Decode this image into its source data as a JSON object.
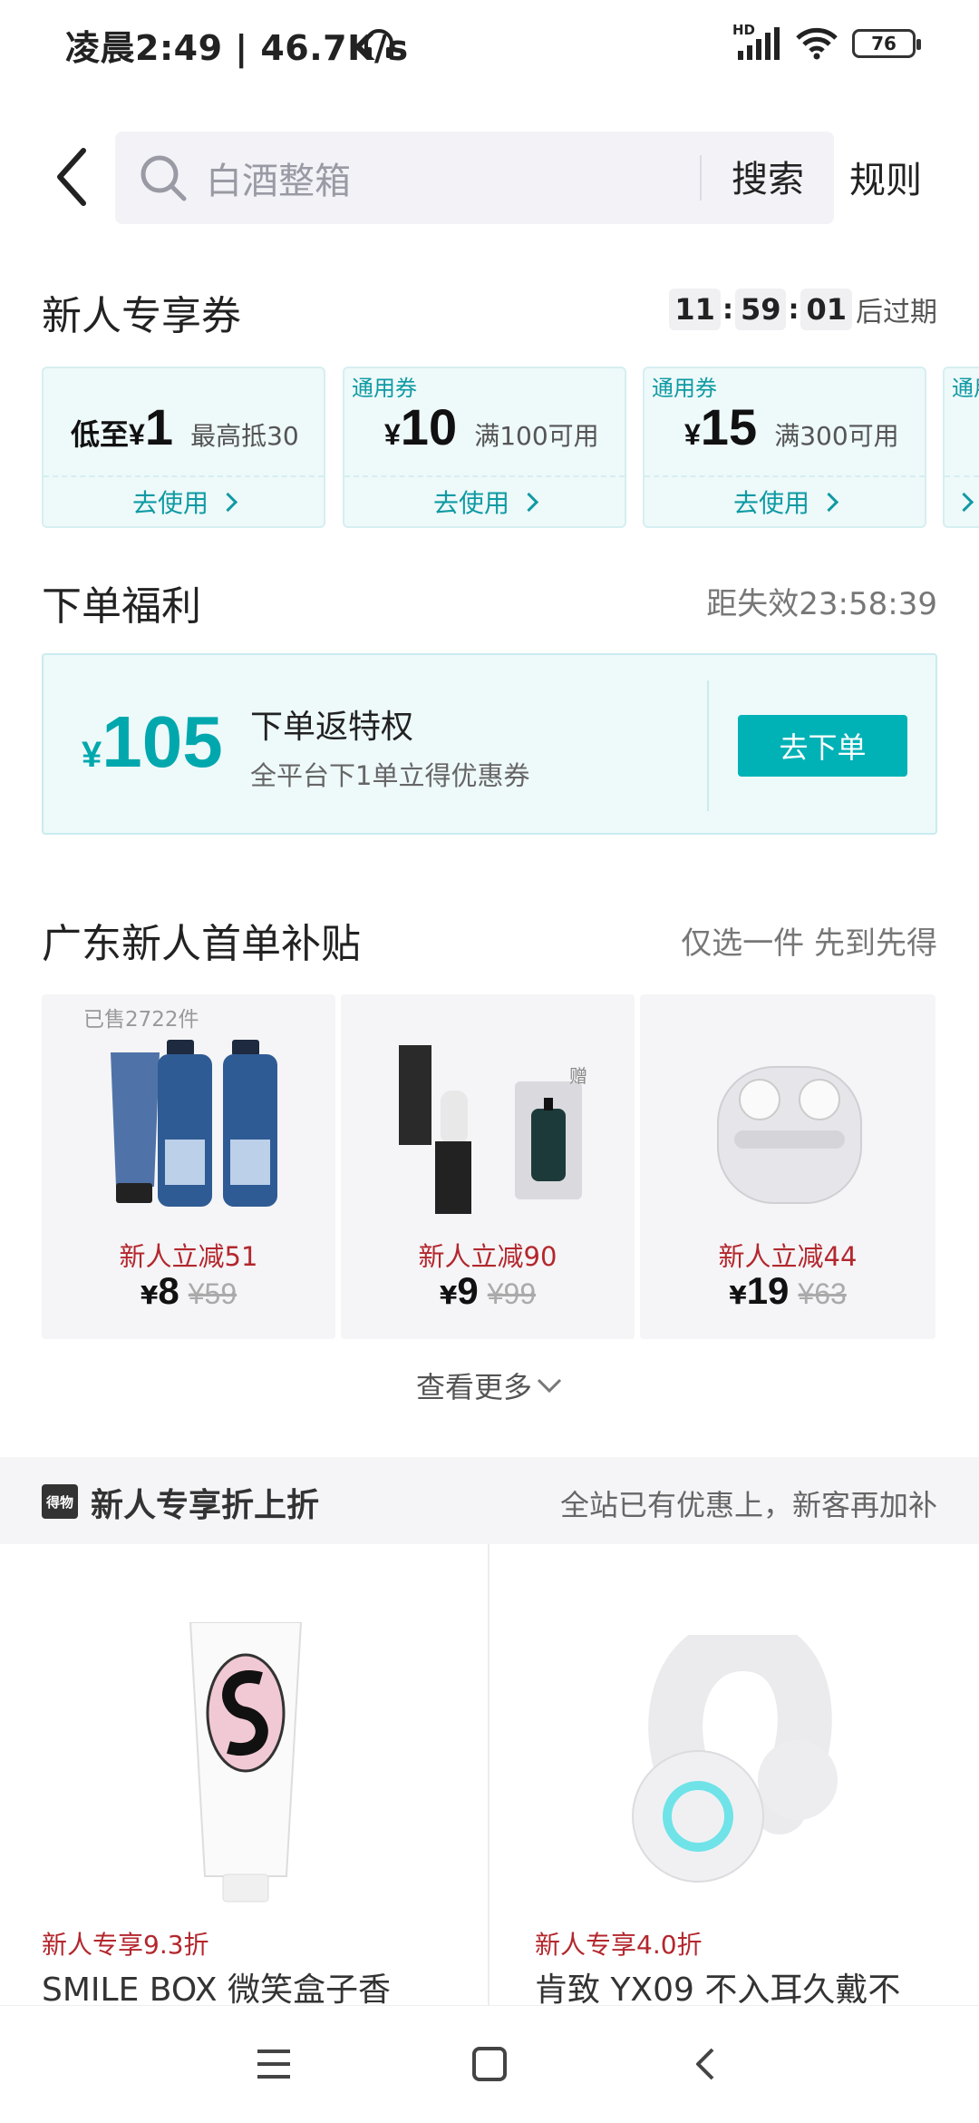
{
  "status": {
    "time": "凌晨2:49 | 46.7K/s",
    "hd": "HD",
    "battery": "76"
  },
  "header": {
    "search_placeholder": "白酒整箱",
    "search_button": "搜索",
    "rules_link": "规则"
  },
  "coupons_section": {
    "title": "新人专享券",
    "countdown": {
      "h": "11",
      "m": "59",
      "s": "01",
      "suffix": "后过期"
    },
    "coupons": [
      {
        "tag": "",
        "prefix": "低至¥",
        "amount": "1",
        "condition": "最高抵30",
        "action": "去使用"
      },
      {
        "tag": "通用券",
        "prefix": "¥",
        "amount": "10",
        "condition": "满100可用",
        "action": "去使用"
      },
      {
        "tag": "通用券",
        "prefix": "¥",
        "amount": "15",
        "condition": "满300可用",
        "action": "去使用"
      },
      {
        "tag": "通用",
        "prefix": "",
        "amount": "",
        "condition": "",
        "action": ""
      }
    ]
  },
  "order_benefit": {
    "title": "下单福利",
    "expiry": "距失效23:58:39",
    "currency": "¥",
    "amount": "105",
    "heading": "下单返特权",
    "desc": "全平台下1单立得优惠券",
    "cta": "去下单"
  },
  "first_order": {
    "title": "广东新人首单补贴",
    "note": "仅选一件 先到先得",
    "sold_count": "已售2722件",
    "products": [
      {
        "promo": "新人立减51",
        "currency": "¥",
        "price": "8",
        "old_price": "¥59"
      },
      {
        "promo": "新人立减90",
        "currency": "¥",
        "price": "9",
        "old_price": "¥99",
        "gift_label": "赠"
      },
      {
        "promo": "新人立减44",
        "currency": "¥",
        "price": "19",
        "old_price": "¥63"
      }
    ],
    "see_more": "查看更多"
  },
  "discount_section": {
    "logo_text": "得物",
    "title": "新人专享折上折",
    "note": "全站已有优惠上，新客再加补",
    "items": [
      {
        "tag": "新人专享9.3折",
        "title": "SMILE BOX 微笑盒子香"
      },
      {
        "tag": "新人专享4.0折",
        "title": "肯致 YX09 不入耳久戴不"
      }
    ]
  },
  "colors": {
    "accent": "#00b2b6",
    "promo_red": "#b3272d",
    "coupon_bg": "#eef9fa"
  }
}
